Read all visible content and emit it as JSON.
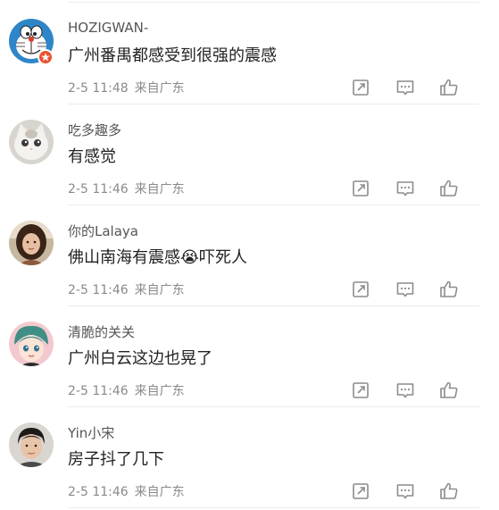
{
  "comments": [
    {
      "username": "HOZIGWAN-",
      "text": "广州番禺都感受到很强的震感",
      "time": "2-5 11:48",
      "location": "来自广东",
      "avatar": "doraemon-avatar",
      "has_badge": true
    },
    {
      "username": "吃多趣多",
      "text": "有感觉",
      "time": "2-5 11:46",
      "location": "来自广东",
      "avatar": "cat-avatar"
    },
    {
      "username": "你的Lalaya",
      "text": "佛山南海有震感😭吓死人",
      "time": "2-5 11:46",
      "location": "来自广东",
      "avatar": "woman-photo-avatar"
    },
    {
      "username": "清脆的关关",
      "text": "广州白云这边也晃了",
      "time": "2-5 11:46",
      "location": "来自广东",
      "avatar": "cartoon-boy-avatar"
    },
    {
      "username": "Yin小宋",
      "text": "房子抖了几下",
      "time": "2-5 11:46",
      "location": "来自广东",
      "avatar": "man-photo-avatar"
    }
  ],
  "icons": {
    "forward": "forward-icon",
    "reply": "comment-icon",
    "like": "thumbs-up-icon"
  },
  "colors": {
    "icon": "#8c8c8c",
    "username": "#555555",
    "text": "#222222",
    "meta": "#8a8a8a",
    "badge": "#e8532f"
  }
}
